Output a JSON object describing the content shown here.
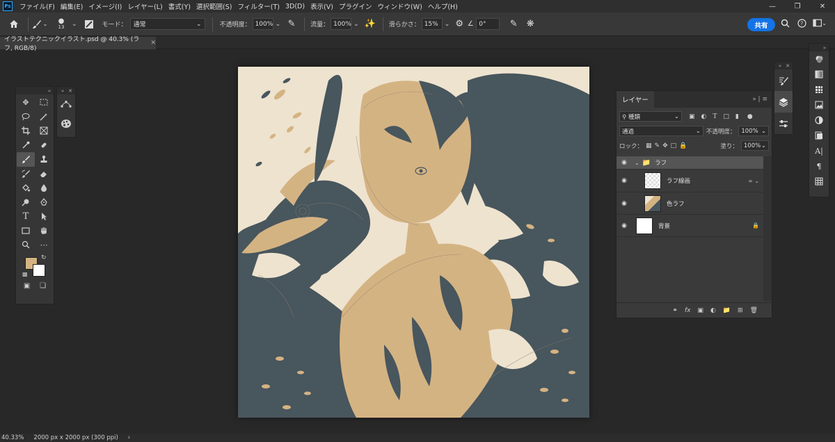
{
  "app": {
    "logo_text": "Ps"
  },
  "menu": [
    "ファイル(F)",
    "編集(E)",
    "イメージ(I)",
    "レイヤー(L)",
    "書式(Y)",
    "選択範囲(S)",
    "フィルター(T)",
    "3D(D)",
    "表示(V)",
    "プラグイン",
    "ウィンドウ(W)",
    "ヘルプ(H)"
  ],
  "options": {
    "brush_size": "13",
    "mode_label": "モード：",
    "mode_value": "通常",
    "opacity_label": "不透明度：",
    "opacity_value": "100%",
    "flow_label": "流量：",
    "flow_value": "100%",
    "smoothing_label": "滑らかさ：",
    "smoothing_value": "15%",
    "angle_value": "0°",
    "share_label": "共有"
  },
  "document": {
    "tab_title": "イラストテクニックイラスト.psd @ 40.3% (ラフ, RGB/8)"
  },
  "colors": {
    "foreground": "#d4b383",
    "background": "#ffffff",
    "accent": "#1473e6"
  },
  "layers_panel": {
    "tab_label": "レイヤー",
    "filter_value": "種類",
    "blend_value": "通過",
    "opacity_label": "不透明度：",
    "opacity_value": "100%",
    "lock_label": "ロック：",
    "fill_label": "塗り：",
    "fill_value": "100%",
    "layers": [
      {
        "name": "ラフ",
        "type": "group"
      },
      {
        "name": "ラフ線画",
        "type": "layer"
      },
      {
        "name": "色ラフ",
        "type": "layer"
      },
      {
        "name": "背景",
        "type": "background"
      }
    ]
  },
  "status": {
    "zoom": "40.33%",
    "doc_info": "2000 px x 2000 px (300 ppi)",
    "arrow": "›"
  }
}
